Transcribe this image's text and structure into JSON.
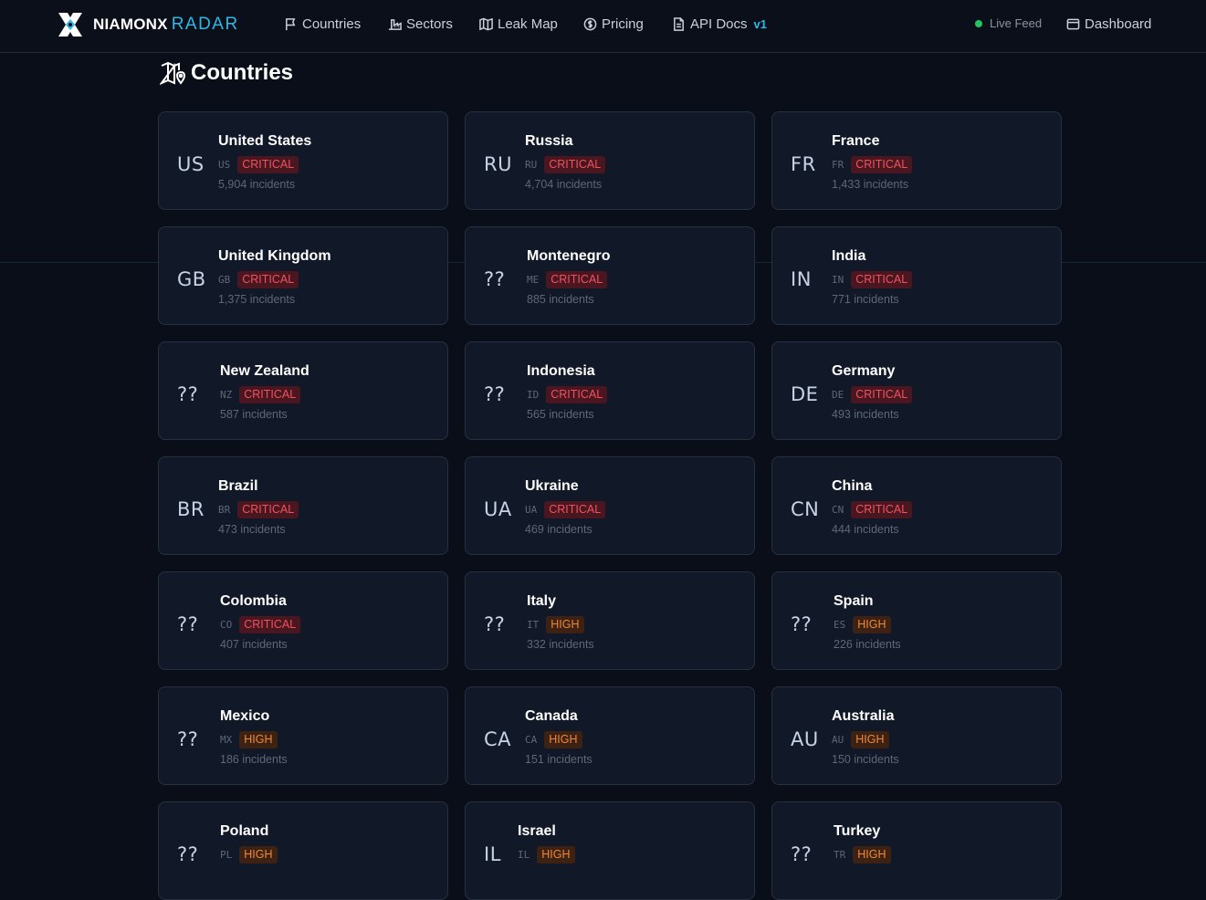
{
  "brand": {
    "name": "NIAMONX",
    "suffix": "RADAR"
  },
  "nav": [
    {
      "label": "Countries",
      "icon": "flag-icon"
    },
    {
      "label": "Sectors",
      "icon": "factory-icon"
    },
    {
      "label": "Leak Map",
      "icon": "map-icon"
    },
    {
      "label": "Pricing",
      "icon": "dollar-icon"
    },
    {
      "label": "API Docs",
      "icon": "document-icon",
      "badge": "v1"
    }
  ],
  "live_feed": "Live Feed",
  "dashboard": {
    "label": "Dashboard",
    "icon": "dashboard-icon"
  },
  "page_title": "Countries",
  "colors": {
    "accent": "#2fb7e6",
    "critical": "#f0525f",
    "high": "#f0883b",
    "live": "#22c55e"
  },
  "countries": [
    {
      "flag": "US",
      "name": "United States",
      "code": "US",
      "level": "CRITICAL",
      "count": "5,904 incidents"
    },
    {
      "flag": "RU",
      "name": "Russia",
      "code": "RU",
      "level": "CRITICAL",
      "count": "4,704 incidents"
    },
    {
      "flag": "FR",
      "name": "France",
      "code": "FR",
      "level": "CRITICAL",
      "count": "1,433 incidents"
    },
    {
      "flag": "GB",
      "name": "United Kingdom",
      "code": "GB",
      "level": "CRITICAL",
      "count": "1,375 incidents"
    },
    {
      "flag": "??",
      "name": "Montenegro",
      "code": "ME",
      "level": "CRITICAL",
      "count": "885 incidents"
    },
    {
      "flag": "IN",
      "name": "India",
      "code": "IN",
      "level": "CRITICAL",
      "count": "771 incidents"
    },
    {
      "flag": "??",
      "name": "New Zealand",
      "code": "NZ",
      "level": "CRITICAL",
      "count": "587 incidents"
    },
    {
      "flag": "??",
      "name": "Indonesia",
      "code": "ID",
      "level": "CRITICAL",
      "count": "565 incidents"
    },
    {
      "flag": "DE",
      "name": "Germany",
      "code": "DE",
      "level": "CRITICAL",
      "count": "493 incidents"
    },
    {
      "flag": "BR",
      "name": "Brazil",
      "code": "BR",
      "level": "CRITICAL",
      "count": "473 incidents"
    },
    {
      "flag": "UA",
      "name": "Ukraine",
      "code": "UA",
      "level": "CRITICAL",
      "count": "469 incidents"
    },
    {
      "flag": "CN",
      "name": "China",
      "code": "CN",
      "level": "CRITICAL",
      "count": "444 incidents"
    },
    {
      "flag": "??",
      "name": "Colombia",
      "code": "CO",
      "level": "CRITICAL",
      "count": "407 incidents"
    },
    {
      "flag": "??",
      "name": "Italy",
      "code": "IT",
      "level": "HIGH",
      "count": "332 incidents"
    },
    {
      "flag": "??",
      "name": "Spain",
      "code": "ES",
      "level": "HIGH",
      "count": "226 incidents"
    },
    {
      "flag": "??",
      "name": "Mexico",
      "code": "MX",
      "level": "HIGH",
      "count": "186 incidents"
    },
    {
      "flag": "CA",
      "name": "Canada",
      "code": "CA",
      "level": "HIGH",
      "count": "151 incidents"
    },
    {
      "flag": "AU",
      "name": "Australia",
      "code": "AU",
      "level": "HIGH",
      "count": "150 incidents"
    },
    {
      "flag": "??",
      "name": "Poland",
      "code": "PL",
      "level": "HIGH",
      "count": ""
    },
    {
      "flag": "IL",
      "name": "Israel",
      "code": "IL",
      "level": "HIGH",
      "count": ""
    },
    {
      "flag": "??",
      "name": "Turkey",
      "code": "TR",
      "level": "HIGH",
      "count": ""
    }
  ]
}
